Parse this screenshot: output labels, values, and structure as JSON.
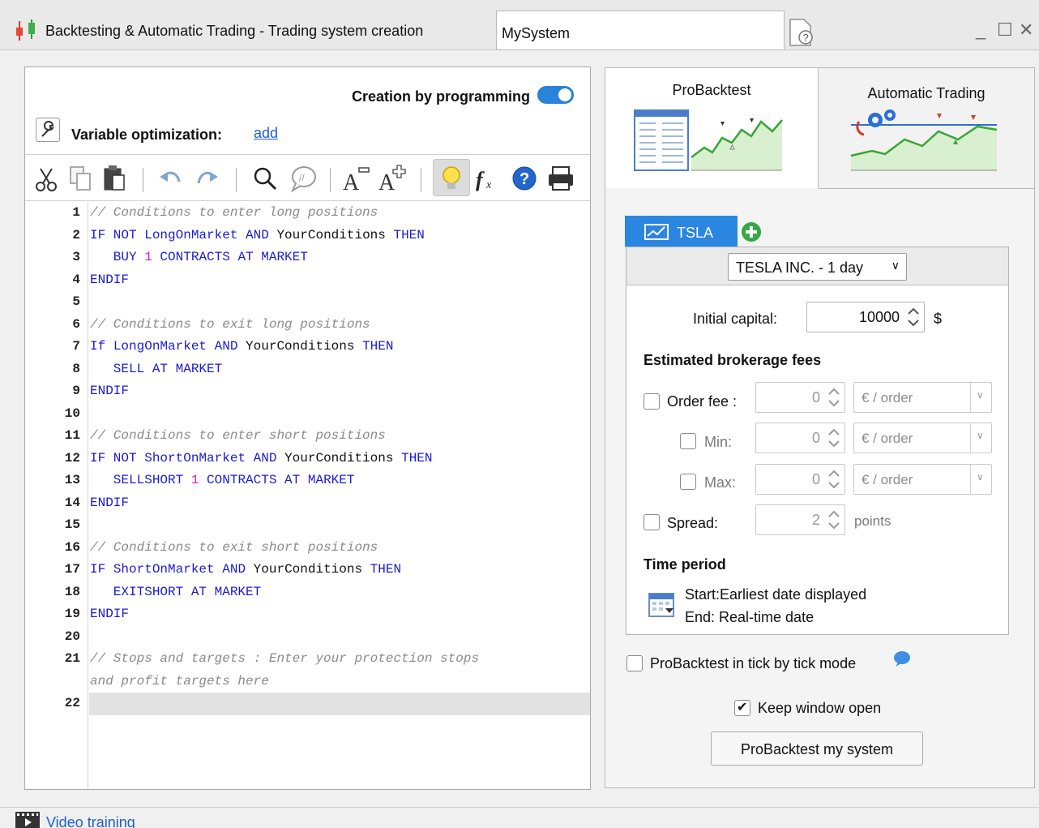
{
  "window": {
    "title": "Backtesting & Automatic Trading - Trading system creation",
    "system_name": "MySystem",
    "controls": {
      "minimize": "_",
      "maximize": "☐",
      "close": "✕"
    }
  },
  "editor": {
    "creation_mode_label": "Creation by programming",
    "creation_mode_on": true,
    "variable_optimization_label": "Variable optimization:",
    "variable_optimization_link": "add",
    "toolbar_icons": [
      "cut-icon",
      "copy-icon",
      "paste-icon",
      "undo-icon",
      "redo-icon",
      "search-icon",
      "comment-icon",
      "decrease-font-icon",
      "increase-font-icon",
      "lightbulb-icon",
      "function-icon",
      "help-icon",
      "print-icon"
    ],
    "current_line": "22",
    "lines": [
      {
        "n": "1",
        "parts": [
          {
            "t": "// Conditions to enter long positions",
            "c": "cmt"
          }
        ]
      },
      {
        "n": "2",
        "parts": [
          {
            "t": "IF NOT ",
            "c": "kw"
          },
          {
            "t": "LongOnMarket",
            "c": "kw"
          },
          {
            "t": " AND ",
            "c": "kw"
          },
          {
            "t": "YourConditions",
            "c": "ident"
          },
          {
            "t": " THEN",
            "c": "kw"
          }
        ]
      },
      {
        "n": "3",
        "parts": [
          {
            "t": "   BUY ",
            "c": "kw"
          },
          {
            "t": "1",
            "c": "num"
          },
          {
            "t": " CONTRACTS AT MARKET",
            "c": "kw"
          }
        ]
      },
      {
        "n": "4",
        "parts": [
          {
            "t": "ENDIF",
            "c": "kw"
          }
        ]
      },
      {
        "n": "5",
        "parts": []
      },
      {
        "n": "6",
        "parts": [
          {
            "t": "// Conditions to exit long positions",
            "c": "cmt"
          }
        ]
      },
      {
        "n": "7",
        "parts": [
          {
            "t": "If ",
            "c": "kw"
          },
          {
            "t": "LongOnMarket",
            "c": "kw"
          },
          {
            "t": " AND ",
            "c": "kw"
          },
          {
            "t": "YourConditions",
            "c": "ident"
          },
          {
            "t": " THEN",
            "c": "kw"
          }
        ]
      },
      {
        "n": "8",
        "parts": [
          {
            "t": "   SELL AT MARKET",
            "c": "kw"
          }
        ]
      },
      {
        "n": "9",
        "parts": [
          {
            "t": "ENDIF",
            "c": "kw"
          }
        ]
      },
      {
        "n": "10",
        "parts": []
      },
      {
        "n": "11",
        "parts": [
          {
            "t": "// Conditions to enter short positions",
            "c": "cmt"
          }
        ]
      },
      {
        "n": "12",
        "parts": [
          {
            "t": "IF NOT ",
            "c": "kw"
          },
          {
            "t": "ShortOnMarket",
            "c": "kw"
          },
          {
            "t": " AND ",
            "c": "kw"
          },
          {
            "t": "YourConditions",
            "c": "ident"
          },
          {
            "t": " THEN",
            "c": "kw"
          }
        ]
      },
      {
        "n": "13",
        "parts": [
          {
            "t": "   SELLSHORT ",
            "c": "kw"
          },
          {
            "t": "1",
            "c": "num"
          },
          {
            "t": " CONTRACTS AT MARKET",
            "c": "kw"
          }
        ]
      },
      {
        "n": "14",
        "parts": [
          {
            "t": "ENDIF",
            "c": "kw"
          }
        ]
      },
      {
        "n": "15",
        "parts": []
      },
      {
        "n": "16",
        "parts": [
          {
            "t": "// Conditions to exit short positions",
            "c": "cmt"
          }
        ]
      },
      {
        "n": "17",
        "parts": [
          {
            "t": "IF ",
            "c": "kw"
          },
          {
            "t": "ShortOnMarket",
            "c": "kw"
          },
          {
            "t": " AND ",
            "c": "kw"
          },
          {
            "t": "YourConditions",
            "c": "ident"
          },
          {
            "t": " THEN",
            "c": "kw"
          }
        ]
      },
      {
        "n": "18",
        "parts": [
          {
            "t": "   EXITSHORT AT MARKET",
            "c": "kw"
          }
        ]
      },
      {
        "n": "19",
        "parts": [
          {
            "t": "ENDIF",
            "c": "kw"
          }
        ]
      },
      {
        "n": "20",
        "parts": []
      },
      {
        "n": "21",
        "parts": [
          {
            "t": "// Stops and targets : Enter your protection stops",
            "c": "cmt"
          }
        ]
      },
      {
        "n": "",
        "parts": [
          {
            "t": "and profit targets here",
            "c": "cmt"
          }
        ]
      },
      {
        "n": "22",
        "parts": []
      }
    ]
  },
  "right": {
    "tabs": [
      {
        "label": "ProBacktest",
        "active": true
      },
      {
        "label": "Automatic Trading",
        "active": false
      }
    ],
    "instrument_tab": "TSLA",
    "instrument_select": "TESLA INC. - 1 day",
    "initial_capital_label": "Initial capital:",
    "initial_capital_value": "10000",
    "currency": "$",
    "fees_heading": "Estimated brokerage fees",
    "order_fee": {
      "label": "Order fee :",
      "value": "0",
      "unit": "€ / order",
      "checked": false
    },
    "min_fee": {
      "label": "Min:",
      "value": "0",
      "unit": "€ / order",
      "checked": false
    },
    "max_fee": {
      "label": "Max:",
      "value": "0",
      "unit": "€ / order",
      "checked": false
    },
    "spread": {
      "label": "Spread:",
      "value": "2",
      "unit": "points",
      "checked": false
    },
    "time_period_heading": "Time period",
    "start_text": "Start:Earliest date displayed",
    "end_text": "End: Real-time date",
    "tick_mode_label": "ProBacktest in tick by tick mode",
    "tick_mode_checked": false,
    "keep_open_label": "Keep window open",
    "keep_open_checked": true,
    "run_button": "ProBacktest my system"
  },
  "footer": {
    "video_link": "Video training"
  },
  "colors": {
    "accent": "#2a86e0",
    "keyword": "#1b1bd6",
    "number": "#d11bd6",
    "comment": "#8a8a8a",
    "link": "#1f5fcf"
  }
}
